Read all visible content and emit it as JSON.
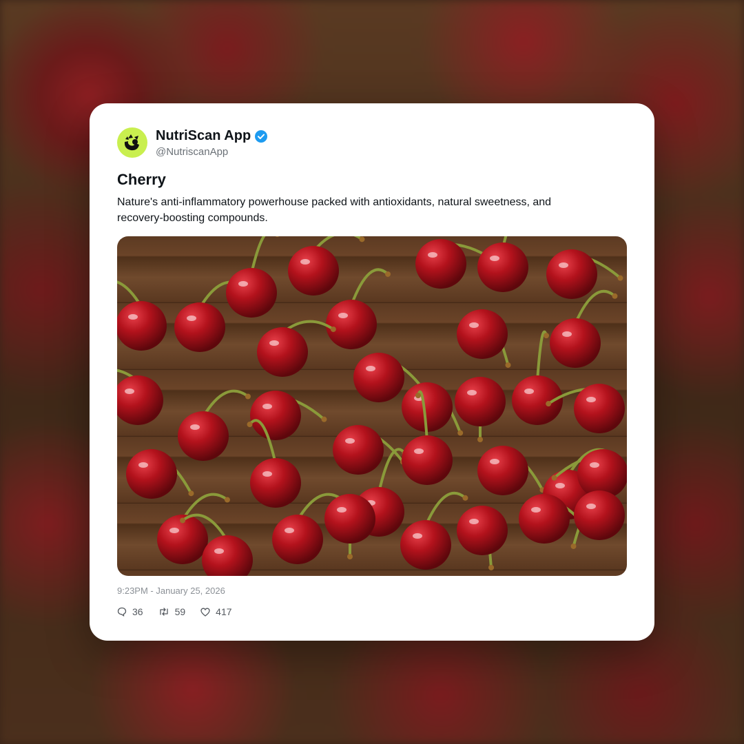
{
  "post": {
    "author_name": "NutriScan App",
    "author_handle": "@NutriscanApp",
    "title": "Cherry",
    "description": "Nature's anti-inflammatory powerhouse packed with antioxidants, natural sweetness, and recovery-boosting compounds.",
    "timestamp": "9:23PM - January 25, 2026",
    "stats": {
      "replies": "36",
      "reposts": "59",
      "likes": "417"
    }
  },
  "icons": {
    "avatar": "nutriscan-logo-icon",
    "verified": "verified-badge-icon",
    "reply": "reply-icon",
    "repost": "repost-icon",
    "like": "heart-icon"
  },
  "colors": {
    "avatar_bg": "#c9ef4f",
    "verified": "#1d9bf0",
    "cherry": "#b3121c",
    "wood": "#5c3a22"
  }
}
